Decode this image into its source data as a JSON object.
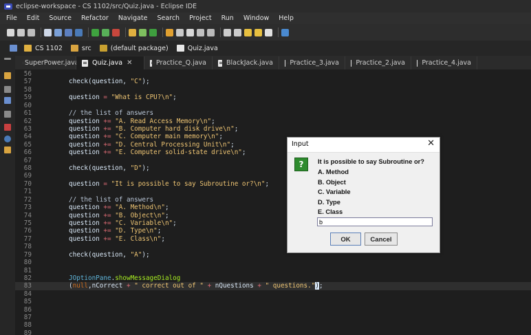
{
  "window": {
    "title": "eclipse-workspace - CS 1102/src/Quiz.java - Eclipse IDE"
  },
  "menu": [
    "File",
    "Edit",
    "Source",
    "Refactor",
    "Navigate",
    "Search",
    "Project",
    "Run",
    "Window",
    "Help"
  ],
  "breadcrumbs": [
    "CS 1102",
    "src",
    "(default package)",
    "Quiz.java"
  ],
  "tabs": [
    {
      "label": "SuperPower.java",
      "active": false
    },
    {
      "label": "Quiz.java",
      "active": true
    },
    {
      "label": "Practice_Q.java",
      "active": false
    },
    {
      "label": "BlackJack.java",
      "active": false
    },
    {
      "label": "Practice_3.java",
      "active": false
    },
    {
      "label": "Practice_2.java",
      "active": false
    },
    {
      "label": "Practice_4.java",
      "active": false
    }
  ],
  "close_glyph": "✕",
  "editor": {
    "lines": [
      {
        "n": "56",
        "segs": []
      },
      {
        "n": "57",
        "segs": [
          [
            "check(question, ",
            "pl"
          ],
          [
            "\"C\"",
            "st"
          ],
          [
            ");",
            "pl"
          ]
        ]
      },
      {
        "n": "58",
        "segs": []
      },
      {
        "n": "59",
        "segs": [
          [
            "question ",
            "pl"
          ],
          [
            "=",
            "op"
          ],
          [
            " ",
            "pl"
          ],
          [
            "\"What is CPU?\\n\"",
            "st"
          ],
          [
            ";",
            "pl"
          ]
        ]
      },
      {
        "n": "60",
        "segs": []
      },
      {
        "n": "61",
        "segs": [
          [
            "// the list of answers",
            "cm"
          ]
        ]
      },
      {
        "n": "62",
        "segs": [
          [
            "question ",
            "pl"
          ],
          [
            "+=",
            "op"
          ],
          [
            " ",
            "pl"
          ],
          [
            "\"A. Read Access Memory\\n\"",
            "st"
          ],
          [
            ";",
            "pl"
          ]
        ]
      },
      {
        "n": "63",
        "segs": [
          [
            "question ",
            "pl"
          ],
          [
            "+=",
            "op"
          ],
          [
            " ",
            "pl"
          ],
          [
            "\"B. Computer hard disk drive\\n\"",
            "st"
          ],
          [
            ";",
            "pl"
          ]
        ]
      },
      {
        "n": "64",
        "segs": [
          [
            "question ",
            "pl"
          ],
          [
            "+=",
            "op"
          ],
          [
            " ",
            "pl"
          ],
          [
            "\"C. Computer main memory\\n\"",
            "st"
          ],
          [
            ";",
            "pl"
          ]
        ]
      },
      {
        "n": "65",
        "segs": [
          [
            "question ",
            "pl"
          ],
          [
            "+=",
            "op"
          ],
          [
            " ",
            "pl"
          ],
          [
            "\"D. Central Processing Unit\\n\"",
            "st"
          ],
          [
            ";",
            "pl"
          ]
        ]
      },
      {
        "n": "66",
        "segs": [
          [
            "question ",
            "pl"
          ],
          [
            "+=",
            "op"
          ],
          [
            " ",
            "pl"
          ],
          [
            "\"E. Computer solid-state drive\\n\"",
            "st"
          ],
          [
            ";",
            "pl"
          ]
        ]
      },
      {
        "n": "67",
        "segs": []
      },
      {
        "n": "68",
        "segs": [
          [
            "check(question, ",
            "pl"
          ],
          [
            "\"D\"",
            "st"
          ],
          [
            ");",
            "pl"
          ]
        ]
      },
      {
        "n": "69",
        "segs": []
      },
      {
        "n": "70",
        "segs": [
          [
            "question ",
            "pl"
          ],
          [
            "=",
            "op"
          ],
          [
            " ",
            "pl"
          ],
          [
            "\"It is possible to say Subroutine or?\\n\"",
            "st"
          ],
          [
            ";",
            "pl"
          ]
        ]
      },
      {
        "n": "71",
        "segs": []
      },
      {
        "n": "72",
        "segs": [
          [
            "// the list of answers",
            "cm"
          ]
        ]
      },
      {
        "n": "73",
        "segs": [
          [
            "question ",
            "pl"
          ],
          [
            "+=",
            "op"
          ],
          [
            " ",
            "pl"
          ],
          [
            "\"A. Method\\n\"",
            "st"
          ],
          [
            ";",
            "pl"
          ]
        ]
      },
      {
        "n": "74",
        "segs": [
          [
            "question ",
            "pl"
          ],
          [
            "+=",
            "op"
          ],
          [
            " ",
            "pl"
          ],
          [
            "\"B. Object\\n\"",
            "st"
          ],
          [
            ";",
            "pl"
          ]
        ]
      },
      {
        "n": "75",
        "segs": [
          [
            "question ",
            "pl"
          ],
          [
            "+=",
            "op"
          ],
          [
            " ",
            "pl"
          ],
          [
            "\"C. Variable\\n\"",
            "st"
          ],
          [
            ";",
            "pl"
          ]
        ]
      },
      {
        "n": "76",
        "segs": [
          [
            "question ",
            "pl"
          ],
          [
            "+=",
            "op"
          ],
          [
            " ",
            "pl"
          ],
          [
            "\"D. Type\\n\"",
            "st"
          ],
          [
            ";",
            "pl"
          ]
        ]
      },
      {
        "n": "77",
        "segs": [
          [
            "question ",
            "pl"
          ],
          [
            "+=",
            "op"
          ],
          [
            " ",
            "pl"
          ],
          [
            "\"E. Class\\n\"",
            "st"
          ],
          [
            ";",
            "pl"
          ]
        ]
      },
      {
        "n": "78",
        "segs": []
      },
      {
        "n": "79",
        "segs": [
          [
            "check(question, ",
            "pl"
          ],
          [
            "\"A\"",
            "st"
          ],
          [
            ");",
            "pl"
          ]
        ]
      },
      {
        "n": "80",
        "segs": []
      },
      {
        "n": "81",
        "segs": []
      },
      {
        "n": "82",
        "segs": [
          [
            "JOptionPane",
            "cls"
          ],
          [
            ".",
            "pl"
          ],
          [
            "showMessageDialog",
            "fn"
          ]
        ]
      },
      {
        "n": "83",
        "segs": [
          [
            "(",
            "pl"
          ],
          [
            "null",
            "kw"
          ],
          [
            ",nCorrect ",
            "pl"
          ],
          [
            "+",
            "op"
          ],
          [
            " ",
            "pl"
          ],
          [
            "\" correct out of \"",
            "st"
          ],
          [
            " ",
            "pl"
          ],
          [
            "+",
            "op"
          ],
          [
            " nQuestions ",
            "pl"
          ],
          [
            "+",
            "op"
          ],
          [
            " ",
            "pl"
          ],
          [
            "\" questions.\"",
            "st"
          ],
          [
            ")",
            "caret"
          ],
          [
            ";",
            "pl"
          ]
        ],
        "current": true
      },
      {
        "n": "84",
        "segs": []
      },
      {
        "n": "85",
        "segs": []
      },
      {
        "n": "86",
        "segs": []
      },
      {
        "n": "87",
        "segs": []
      },
      {
        "n": "88",
        "segs": []
      },
      {
        "n": "89",
        "segs": []
      }
    ]
  },
  "dialog": {
    "title": "Input",
    "close": "✕",
    "icon": "?",
    "lines": [
      "It is possible to say Subroutine or?",
      "A. Method",
      "B. Object",
      "C. Variable",
      "D. Type",
      "E. Class"
    ],
    "input_value": "b",
    "ok_label": "OK",
    "cancel_label": "Cancel"
  },
  "colors": {
    "accent": "#3b4cb8",
    "string": "#f0c674",
    "operator": "#e06c75",
    "keyword": "#cc6c1d",
    "method": "#a7ec21",
    "class": "#5eb3d8"
  }
}
